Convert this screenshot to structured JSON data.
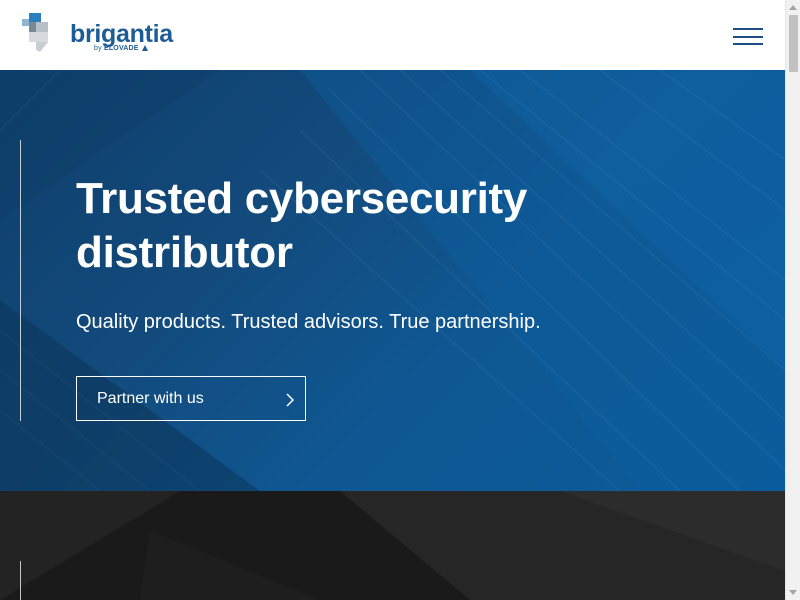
{
  "header": {
    "logo": {
      "brand": "brigantia",
      "sub_prefix": "by",
      "sub_brand": "ELOVADE",
      "color": "#1d5c95"
    },
    "menu_icon": "hamburger-menu-icon"
  },
  "hero": {
    "title": "Trusted cybersecurity distributor",
    "subtitle": "Quality products. Trusted advisors. True partnership.",
    "cta": {
      "label": "Partner with us",
      "icon": "chevron-right-icon"
    },
    "colors": {
      "background": "#134b7d",
      "accent": "#0a5b9c",
      "text": "#ffffff"
    }
  },
  "next_section": {
    "background": "#1a1a1b"
  }
}
